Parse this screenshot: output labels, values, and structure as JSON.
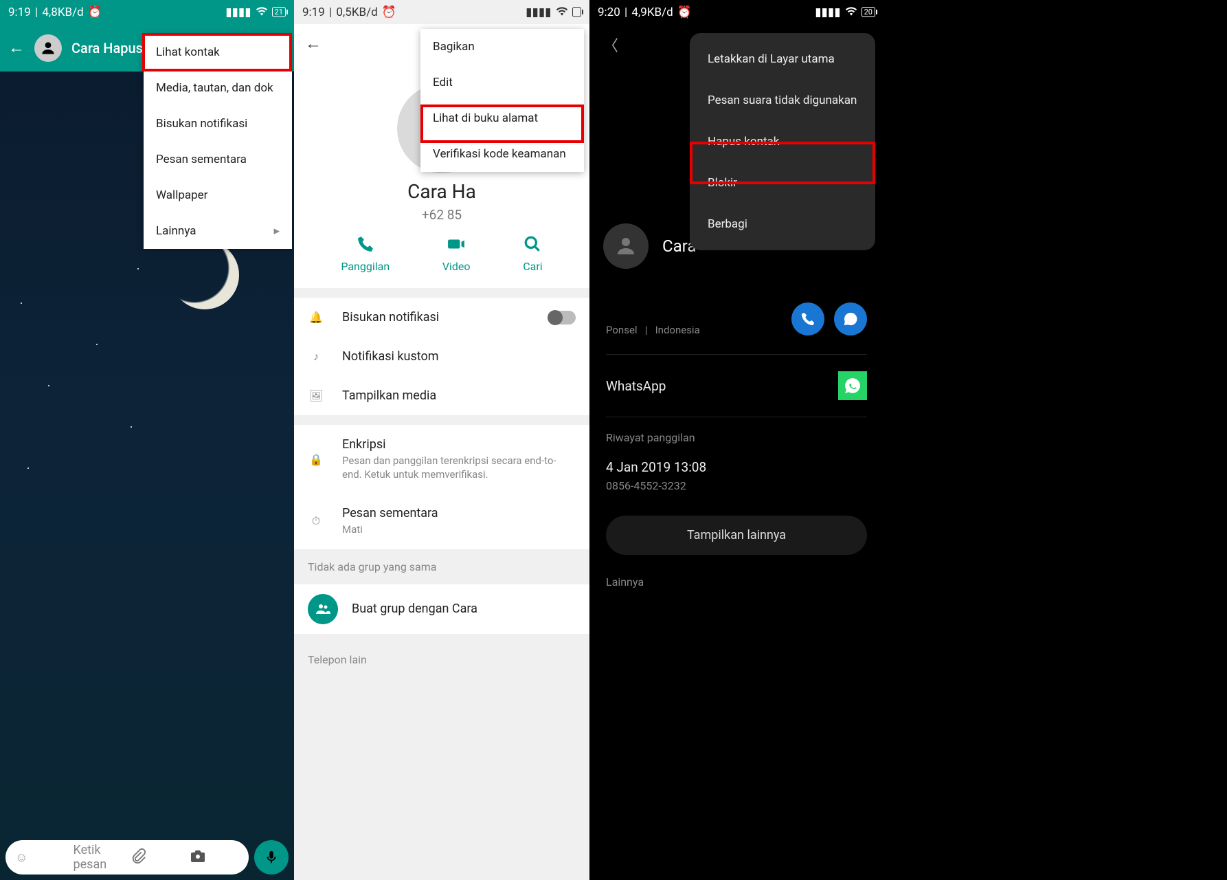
{
  "p1": {
    "status": {
      "time": "9:19",
      "speed": "4,8KB/d",
      "batt": "21"
    },
    "contact": "Cara Hapus Ko",
    "menu": [
      "Lihat kontak",
      "Media, tautan, dan dok",
      "Bisukan notifikasi",
      "Pesan sementara",
      "Wallpaper",
      "Lainnya"
    ],
    "placeholder": "Ketik pesan"
  },
  "p2": {
    "status": {
      "time": "9:19",
      "speed": "0,5KB/d"
    },
    "name": "Cara Ha",
    "phone": "+62 85",
    "actions": {
      "call": "Panggilan",
      "video": "Video",
      "search": "Cari"
    },
    "menu": [
      "Bagikan",
      "Edit",
      "Lihat di buku alamat",
      "Verifikasi kode keamanan"
    ],
    "rows": {
      "mute": "Bisukan notifikasi",
      "custom": "Notifikasi kustom",
      "media": "Tampilkan media",
      "enc": "Enkripsi",
      "enc_sub": "Pesan dan panggilan terenkripsi secara end-to-end. Ketuk untuk memverifikasi.",
      "temp": "Pesan sementara",
      "temp_sub": "Mati"
    },
    "nogroup": "Tidak ada grup yang sama",
    "mkgroup": "Buat grup dengan Cara",
    "other": "Telepon lain"
  },
  "p3": {
    "status": {
      "time": "9:20",
      "speed": "4,9KB/d",
      "batt": "20"
    },
    "name": "Cara ",
    "menu": [
      "Letakkan di Layar utama",
      "Pesan suara tidak digunakan",
      "Hapus kontak",
      "Blokir",
      "Berbagi"
    ],
    "meta": {
      "type": "Ponsel",
      "country": "Indonesia"
    },
    "wa": "WhatsApp",
    "history": "Riwayat panggilan",
    "hist": {
      "date": "4 Jan 2019 13:08",
      "num": "0856-4552-3232"
    },
    "more": "Tampilkan lainnya",
    "other": "Lainnya"
  }
}
